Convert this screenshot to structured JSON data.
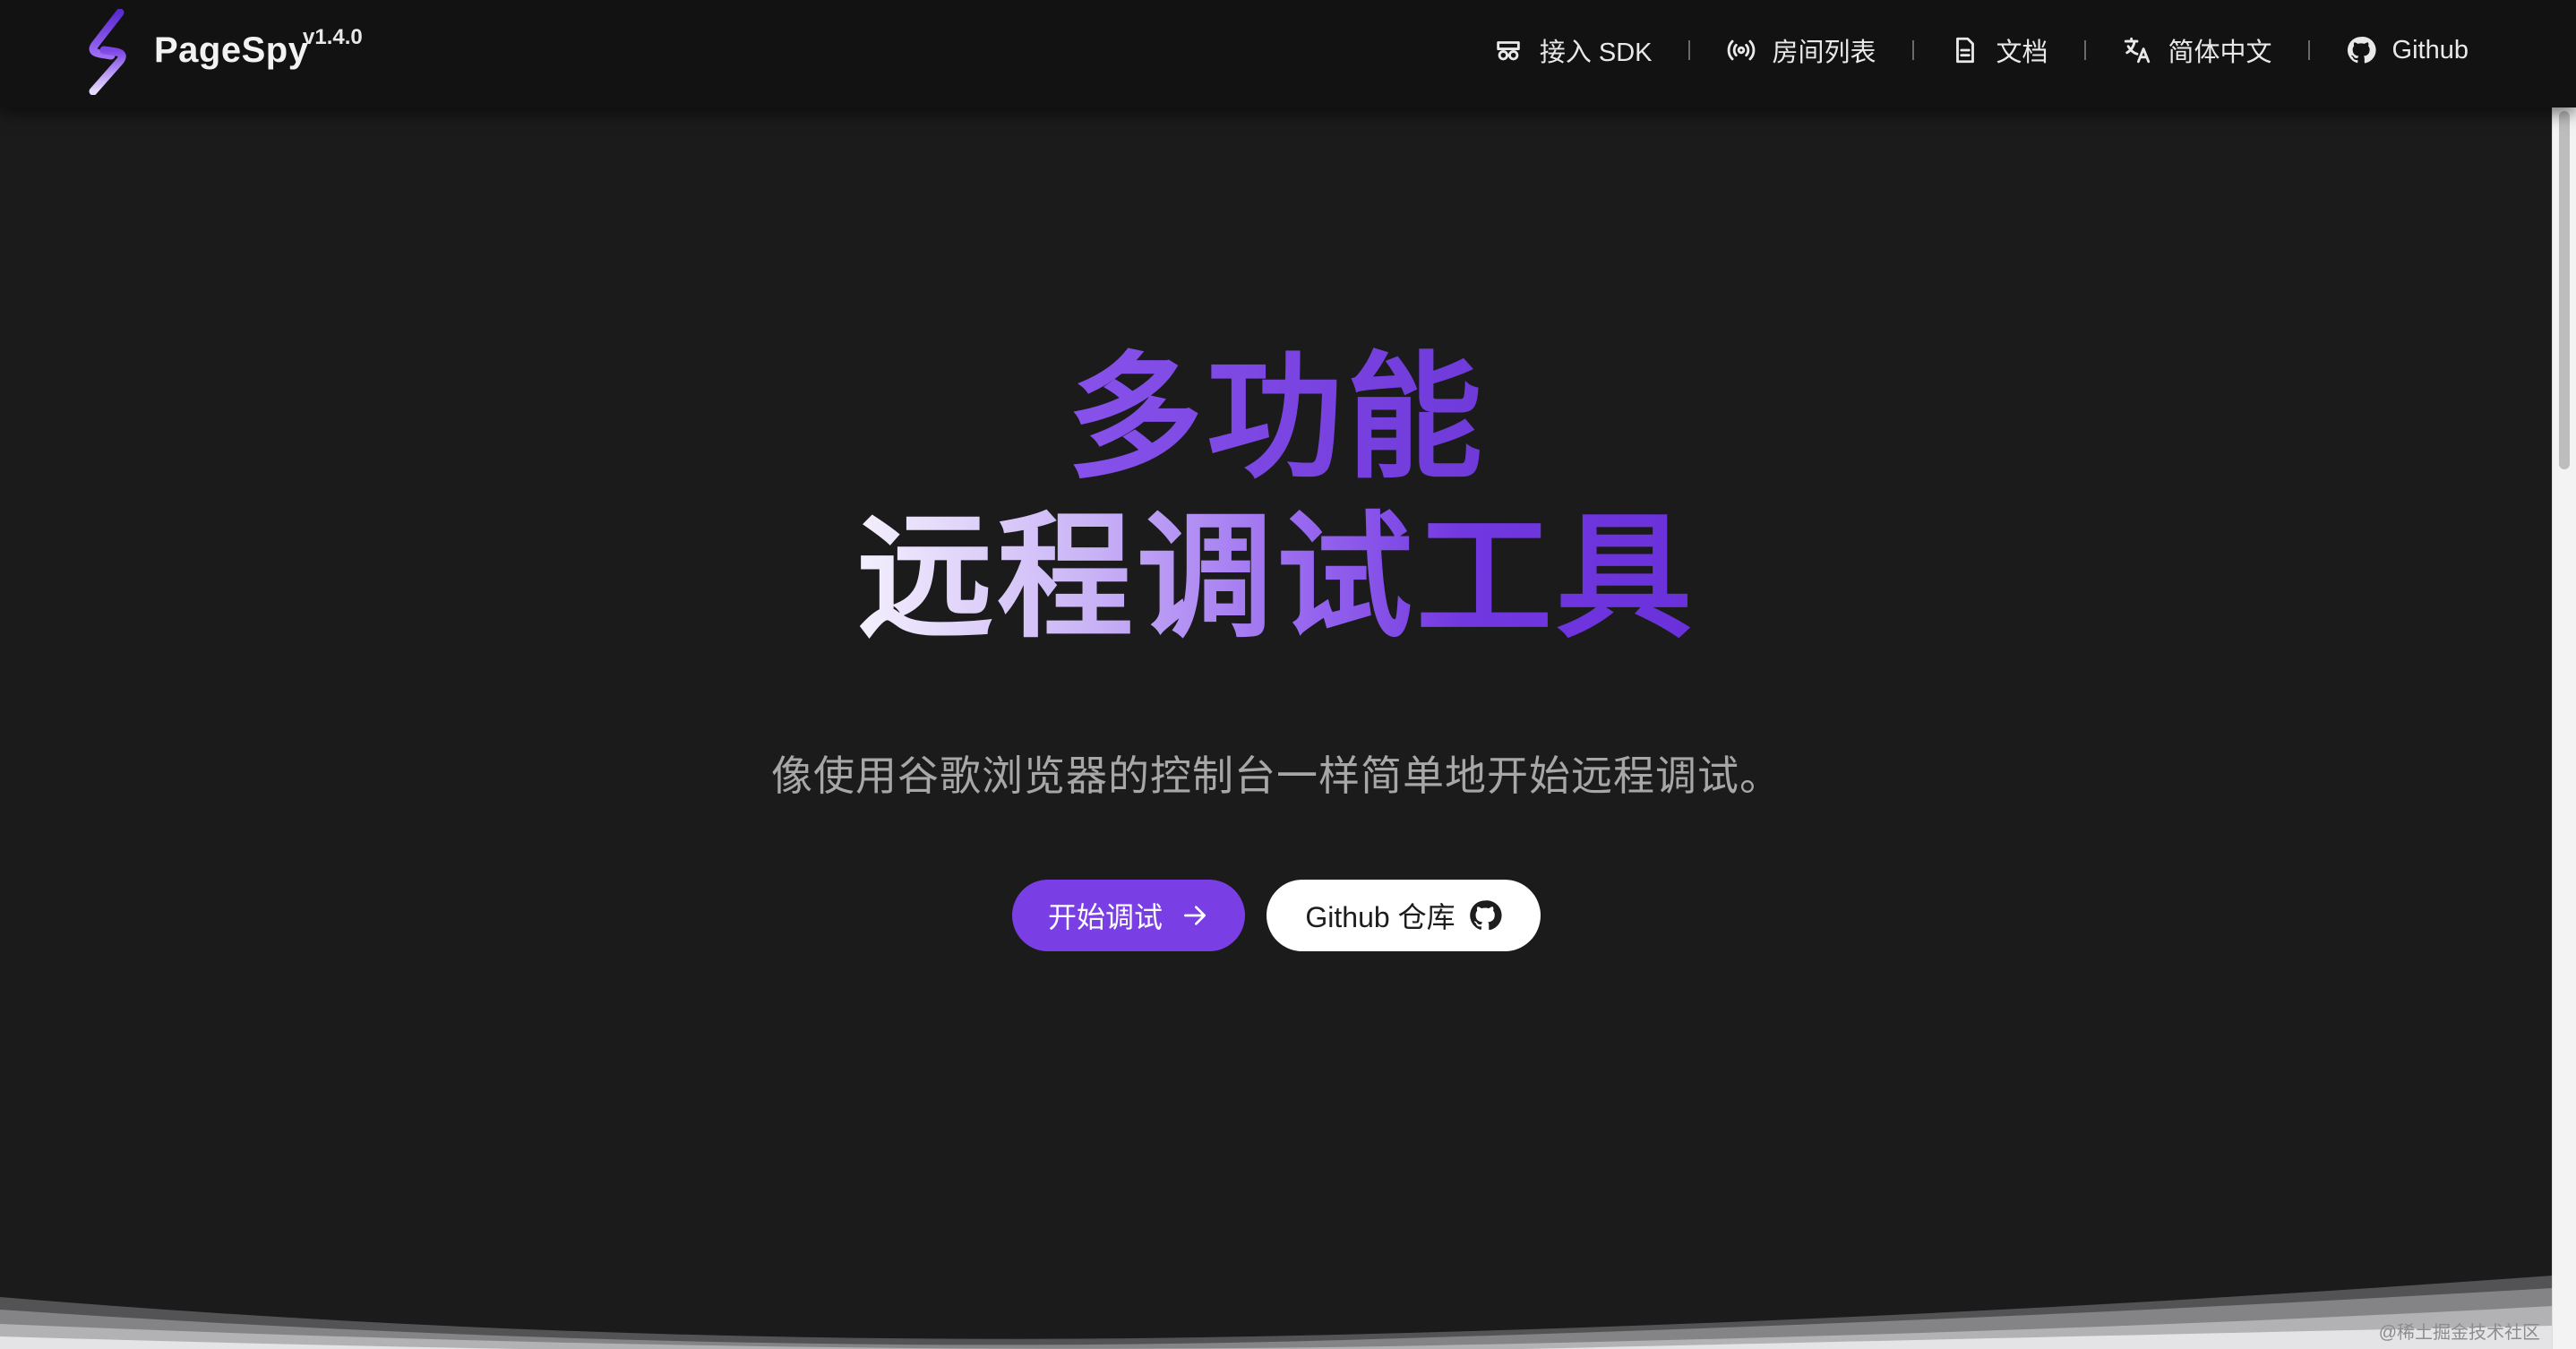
{
  "brand": {
    "name": "PageSpy",
    "version": "v1.4.0"
  },
  "nav": {
    "items": [
      {
        "label": "接入 SDK",
        "icon": "sdk-icon"
      },
      {
        "label": "房间列表",
        "icon": "broadcast-icon"
      },
      {
        "label": "文档",
        "icon": "document-icon"
      },
      {
        "label": "简体中文",
        "icon": "translate-icon"
      },
      {
        "label": "Github",
        "icon": "github-icon"
      }
    ]
  },
  "hero": {
    "title_line1": "多功能",
    "title_line2": "远程调试工具",
    "subtitle": "像使用谷歌浏览器的控制台一样简单地开始远程调试。",
    "primary_button": "开始调试",
    "secondary_button": "Github 仓库"
  },
  "watermark": "@稀土掘金技术社区",
  "colors": {
    "accent": "#7a3fe4",
    "background": "#1b1b1c",
    "topbar": "#121212"
  }
}
